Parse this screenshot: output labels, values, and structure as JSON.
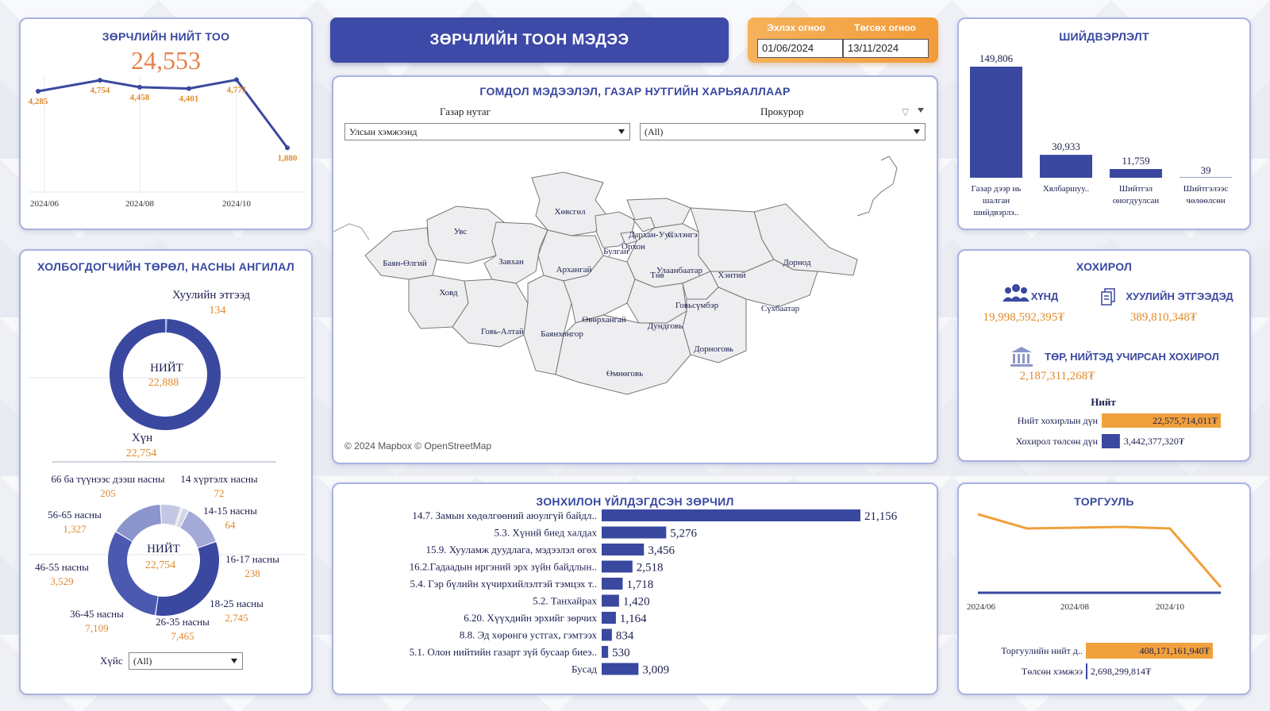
{
  "header": {
    "title": "ЗӨРЧЛИЙН ТООН МЭДЭЭ"
  },
  "dates": {
    "start_label": "Эхлэх огноо",
    "start_value": "01/06/2024",
    "end_label": "Төгсөх огноо",
    "end_value": "13/11/2024"
  },
  "total": {
    "title": "ЗӨРЧЛИЙН НИЙТ ТОО",
    "value": "24,553",
    "points": [
      "4,285",
      "4,754",
      "4,458",
      "4,401",
      "4,775",
      "1,880"
    ],
    "x_ticks": [
      "2024/06",
      "2024/08",
      "2024/10"
    ],
    "values": [
      4285,
      4754,
      4458,
      4401,
      4775,
      1880
    ]
  },
  "persons": {
    "title": "ХОЛБОГДОГЧИЙН ТӨРӨЛ, НАСНЫ АНГИЛАЛ",
    "legal_label": "Хуулийн этгээд",
    "legal_value": "134",
    "total_label": "НИЙТ",
    "total_value": "22,888",
    "human_label": "Хүн",
    "human_value": "22,754",
    "age_total_label": "НИЙТ",
    "age_total_value": "22,754",
    "ages": [
      {
        "label": "66 ба түүнээс дээш насны",
        "value": "205",
        "n": 205
      },
      {
        "label": "14 хүртэлх насны",
        "value": "72",
        "n": 72
      },
      {
        "label": "14-15 насны",
        "value": "64",
        "n": 64
      },
      {
        "label": "16-17 насны",
        "value": "238",
        "n": 238
      },
      {
        "label": "18-25 насны",
        "value": "2,745",
        "n": 2745
      },
      {
        "label": "26-35 насны",
        "value": "7,465",
        "n": 7465
      },
      {
        "label": "36-45 насны",
        "value": "7,109",
        "n": 7109
      },
      {
        "label": "46-55 насны",
        "value": "3,529",
        "n": 3529
      },
      {
        "label": "56-65 насны",
        "value": "1,327",
        "n": 1327
      }
    ],
    "gender_label": "Хүйс",
    "gender_value": "(All)"
  },
  "map": {
    "title": "ГОМДОЛ МЭДЭЭЛЭЛ, ГАЗАР НУТГИЙН ХАРЬЯАЛЛААР",
    "filter1_label": "Газар нутаг",
    "filter1_value": "Улсын хэмжээнд",
    "filter2_label": "Прокурор",
    "filter2_value": "(All)",
    "attribution": "© 2024 Mapbox  © OpenStreetMap",
    "regions": [
      "Увс",
      "Ховсгол",
      "Баян-Өлгий",
      "Завхан",
      "Архангай",
      "Булган",
      "Орхон",
      "Дархан-Уул",
      "Сэлэнгэ",
      "Дорнод",
      "Хэнтий",
      "Улаанбаатар",
      "Төв",
      "Ховд",
      "Говь-Алтай",
      "Баянхонгор",
      "Өвөрхангай",
      "Дундговь",
      "Говьсүмбэр",
      "Сүхбаатар",
      "Дорноговь",
      "Өмнөговь"
    ],
    "region_labels": [
      "Увс",
      "Хөвсгөл",
      "Баян-Өлгий",
      "Завхан",
      "Архангай",
      "Булган",
      "Орхон",
      "Дархан-Уул",
      "Сэлэнгэ",
      "Дорнод",
      "Хэнтий",
      "Улаанбаатар",
      "Төв",
      "Ховд",
      "Говь-Алтай",
      "Баянхонгор",
      "Өвөрхангай",
      "Дундговь",
      "Говьсүмбэр",
      "Сүхбаатар",
      "Дорноговь",
      "Өмнөговь"
    ]
  },
  "decisions": {
    "title": "ШИЙДВЭРЛЭЛТ",
    "bars": [
      {
        "label1": "Газар дээр нь",
        "label2": "шалган",
        "label3": "шийдвэрлэ..",
        "value": "149,806",
        "n": 149806
      },
      {
        "label1": "Хялбаршуу..",
        "label2": "",
        "label3": "",
        "value": "30,933",
        "n": 30933
      },
      {
        "label1": "Шийтгэл",
        "label2": "оногдуулсан",
        "label3": "",
        "value": "11,759",
        "n": 11759
      },
      {
        "label1": "Шийтгэлээс",
        "label2": "чөлөөлсөн",
        "label3": "",
        "value": "39",
        "n": 39
      }
    ]
  },
  "damage": {
    "title": "ХОХИРОЛ",
    "person_label": "ХҮНД",
    "person_value": "19,998,592,395₮",
    "legal_label": "ХУУЛИЙН ЭТГЭЭДЭД",
    "legal_value": "389,810,348₮",
    "state_label": "ТӨР, НИЙТЭД УЧИРСАН ХОХИРОЛ",
    "state_value": "2,187,311,268₮",
    "total_header": "Нийт",
    "total_label": "Нийт хохирлын дүн",
    "total_value": "22,575,714,011₮",
    "paid_label": "Хохирол төлсөн дүн",
    "paid_value": "3,442,377,320₮",
    "colors": {
      "total": "#f0a03c",
      "paid": "#3a48a0"
    }
  },
  "violations": {
    "title": "ЗОНХИЛОН ҮЙЛДЭГДСЭН ЗӨРЧИЛ",
    "items": [
      {
        "label": "14.7. Замын хөдөлгөөний аюулгүй байдл..",
        "value": "21,156",
        "n": 21156
      },
      {
        "label": "5.3. Хүний биед халдах",
        "value": "5,276",
        "n": 5276
      },
      {
        "label": "15.9. Хууламж дуудлага, мэдээлэл өгөх",
        "value": "3,456",
        "n": 3456
      },
      {
        "label": "16.2.Гадаадын иргэний эрх зүйн байдлын..",
        "value": "2,518",
        "n": 2518
      },
      {
        "label": "5.4. Гэр бүлийн хүчирхийлэлтэй тэмцэх т..",
        "value": "1,718",
        "n": 1718
      },
      {
        "label": "5.2. Танхайрах",
        "value": "1,420",
        "n": 1420
      },
      {
        "label": "6.20. Хүүхдийн эрхийг зөрчих",
        "value": "1,164",
        "n": 1164
      },
      {
        "label": "8.8. Эд хөрөнгө устгах, гэмтээх",
        "value": "834",
        "n": 834
      },
      {
        "label": "5.1. Олон нийтийн газарт зүй бусаар биеэ..",
        "value": "530",
        "n": 530
      },
      {
        "label": "Бусад",
        "value": "3,009",
        "n": 3009
      }
    ]
  },
  "fines": {
    "title": "ТОРГУУЛЬ",
    "x_ticks": [
      "2024/06",
      "2024/08",
      "2024/10"
    ],
    "total_label": "Торгуулийн нийт д..",
    "total_value": "408,171,161,940₮",
    "paid_label": "Төлсөн хэмжээ",
    "paid_value": "2,698,299,814₮",
    "colors": {
      "total": "#f0a03c",
      "paid": "#3a48a0"
    }
  }
}
